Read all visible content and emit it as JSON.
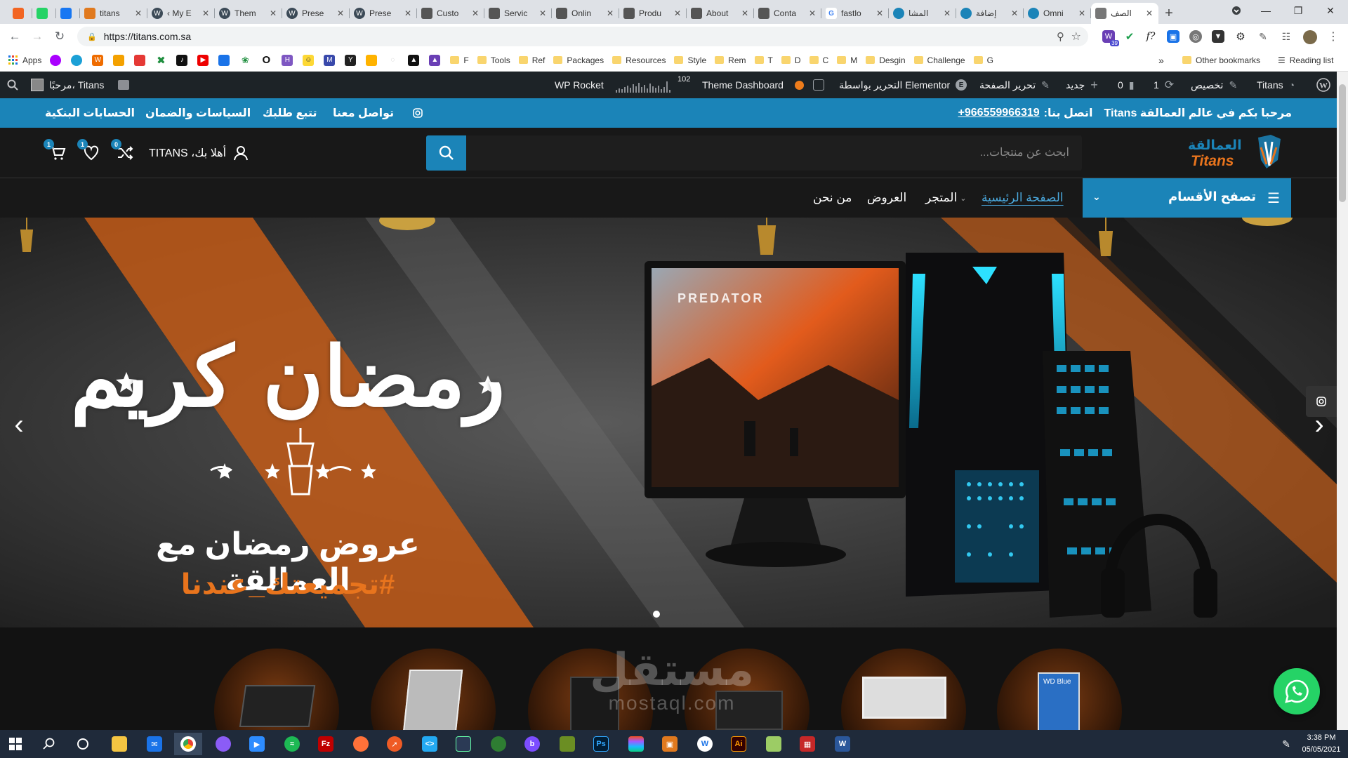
{
  "browser": {
    "tabs": [
      {
        "label": "",
        "fav": "blogger",
        "color": "#f26522"
      },
      {
        "label": "",
        "fav": "whatsapp",
        "color": "#25d366"
      },
      {
        "label": "",
        "fav": "facebook",
        "color": "#1877f2"
      },
      {
        "label": "titans",
        "fav": "titans-logo",
        "color": "#e0791e"
      },
      {
        "label": "‹ My E",
        "fav": "wordpress",
        "color": "#3c4a57"
      },
      {
        "label": "Them",
        "fav": "wordpress",
        "color": "#3c4a57"
      },
      {
        "label": "Prese",
        "fav": "wordpress",
        "color": "#3c4a57"
      },
      {
        "label": "Prese",
        "fav": "wordpress",
        "color": "#3c4a57"
      },
      {
        "label": "Custo",
        "fav": "titans-logo",
        "color": "#555"
      },
      {
        "label": "Servic",
        "fav": "titans-logo",
        "color": "#555"
      },
      {
        "label": "Onlin",
        "fav": "titans-logo",
        "color": "#555"
      },
      {
        "label": "Produ",
        "fav": "titans-logo",
        "color": "#555"
      },
      {
        "label": "About",
        "fav": "titans-logo",
        "color": "#555"
      },
      {
        "label": "Conta",
        "fav": "titans-logo",
        "color": "#555"
      },
      {
        "label": "fastlo",
        "fav": "google",
        "color": "#4285f4"
      },
      {
        "label": "المشا",
        "fav": "circle",
        "color": "#1b84b8"
      },
      {
        "label": "إضافة",
        "fav": "circle",
        "color": "#1b84b8"
      },
      {
        "label": "Omni",
        "fav": "circle",
        "color": "#1b84b8"
      },
      {
        "label": "الصف",
        "fav": "page",
        "color": "#777",
        "active": true
      }
    ],
    "url": "https://titans.com.sa",
    "bookmarks": {
      "apps_label": "Apps",
      "folders": [
        "F",
        "Tools",
        "Ref",
        "Packages",
        "Resources",
        "Style",
        "Rem",
        "T",
        "D",
        "C",
        "M",
        "Desgin",
        "Challenge",
        "G"
      ],
      "other_label": "Other bookmarks",
      "reading_label": "Reading list",
      "more_label": "»"
    },
    "ext_badge": "39"
  },
  "wp_admin": {
    "site_name": "Titans",
    "customize": "تخصيص",
    "updates": "1",
    "comments": "0",
    "new": "جديد",
    "edit_page": "تحرير الصفحة",
    "elementor": "التحرير بواسطة Elementor",
    "theme_dashboard": "Theme Dashboard",
    "wp_rocket": "WP Rocket",
    "stats": "102",
    "howdy": "مرحبًا، Titans"
  },
  "topbar": {
    "welcome": "مرحبا بكم في عالم العمالقة Titans",
    "contact_label": "اتصل بنا:",
    "phone": "+966559966319",
    "links": [
      "الحسابات البنكية",
      "السياسات والضمان",
      "تتبع طلبك",
      "تواصل معنا"
    ]
  },
  "header": {
    "logo_ar": "العمالقة",
    "logo_en": "Titans",
    "search_placeholder": "ابحث عن منتجات...",
    "account_label": "أهلا بك، TITANS",
    "compare_count": "0",
    "wishlist_count": "1",
    "cart_count": "1"
  },
  "nav": {
    "categories_label": "تصفح الأقسام",
    "items": [
      "الصفحة الرئيسية",
      "المتجر",
      "العروض",
      "من نحن"
    ]
  },
  "hero": {
    "title": "رمضان كريم",
    "subtitle": "عروض رمضان مع العمالقة",
    "hashtag": "#تجميعتك_عندنا",
    "monitor_brand": "PREDATOR",
    "slide_count": 1,
    "active_slide": 0
  },
  "watermark": {
    "ar": "مستقل",
    "en": "mostaql.com"
  },
  "taskbar": {
    "time": "3:38 PM",
    "date": "05/05/2021"
  },
  "colors": {
    "brand": "#1b84b8",
    "accent_orange": "#e8741d",
    "dark": "#181818",
    "wp_bar": "#1d2327"
  }
}
